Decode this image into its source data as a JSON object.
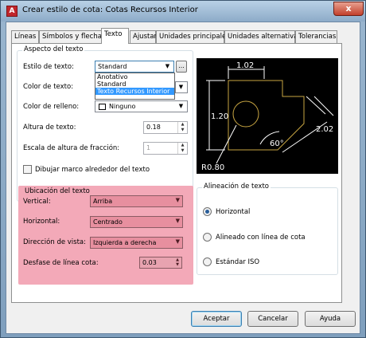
{
  "window": {
    "title": "Crear estilo de cota: Cotas Recursos Interior",
    "close_glyph": "x",
    "icon_glyph": "A"
  },
  "tabs": [
    "Líneas",
    "Símbolos y flechas",
    "Texto",
    "Ajustar",
    "Unidades principales",
    "Unidades alternativas",
    "Tolerancias"
  ],
  "aspecto": {
    "title": "Aspecto del texto",
    "estilo_label": "Estilo de texto:",
    "estilo_value": "Standard",
    "estilo_btn": "...",
    "estilo_options": [
      "Anotativo",
      "Standard",
      "Texto Recursos Interior"
    ],
    "color_texto_label": "Color de texto:",
    "color_relleno_label": "Color de relleno:",
    "color_relleno_value": "Ninguno",
    "altura_label": "Altura de texto:",
    "altura_value": "0.18",
    "escala_label": "Escala de altura de fracción:",
    "escala_value": "1",
    "dibujar_label": "Dibujar marco alrededor del texto"
  },
  "ubicacion": {
    "title": "Ubicación del texto",
    "vertical_label": "Vertical:",
    "vertical_value": "Arriba",
    "horizontal_label": "Horizontal:",
    "horizontal_value": "Centrado",
    "direccion_label": "Dirección de vista:",
    "direccion_value": "Izquierda a derecha",
    "desfase_label": "Desfase de línea cota:",
    "desfase_value": "0.03"
  },
  "preview": {
    "dim1": "1.02",
    "dim2": "1.20",
    "dim3": "2.02",
    "dim4": "60°",
    "dim5": "R0.80"
  },
  "alineacion": {
    "title": "Alineación de texto",
    "options": [
      "Horizontal",
      "Alineado con línea de cota",
      "Estándar ISO"
    ],
    "selected": "Horizontal"
  },
  "buttons": {
    "aceptar": "Aceptar",
    "cancelar": "Cancelar",
    "ayuda": "Ayuda"
  },
  "glyphs": {
    "arrow": "▼",
    "up": "▲",
    "down": "▼"
  },
  "colors": {
    "highlight": "#f3a9b8",
    "preview_line": "#c9a642",
    "selection": "#3399ff"
  }
}
